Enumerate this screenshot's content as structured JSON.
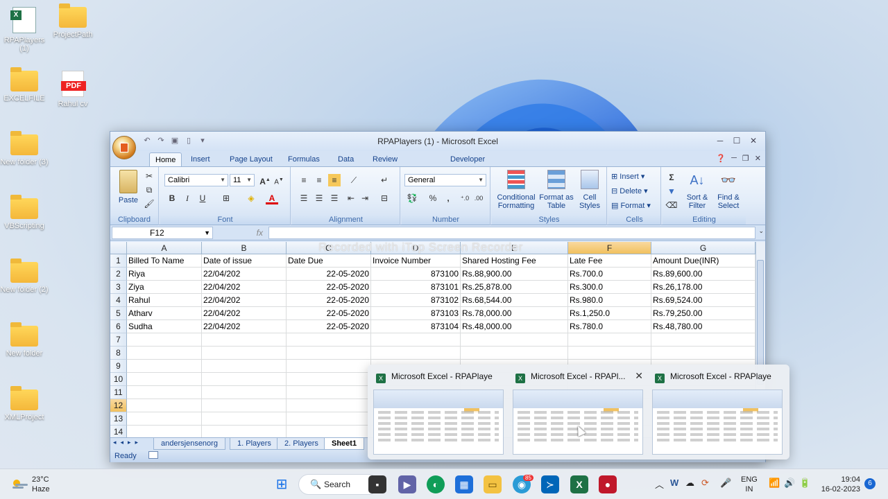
{
  "desktop": {
    "icons": [
      {
        "label": "RPAPlayers (1)",
        "type": "excel"
      },
      {
        "label": "ProjectPath",
        "type": "folder"
      },
      {
        "label": "EXCELFILE",
        "type": "folder"
      },
      {
        "label": "Rahul cv",
        "type": "pdf"
      },
      {
        "label": "New folder (3)",
        "type": "folder"
      },
      {
        "label": "VBScripting",
        "type": "folder"
      },
      {
        "label": "New folder (2)",
        "type": "folder"
      },
      {
        "label": "New folder",
        "type": "folder"
      },
      {
        "label": "XMLProject",
        "type": "folder"
      }
    ],
    "pdf_badge": "PDF",
    "xls_badge": "X"
  },
  "excel": {
    "title": "RPAPlayers (1) - Microsoft Excel",
    "tabs": [
      "Home",
      "Insert",
      "Page Layout",
      "Formulas",
      "Data",
      "Review",
      "Developer"
    ],
    "active_tab": "Home",
    "ribbon": {
      "clipboard": {
        "label": "Clipboard",
        "paste": "Paste"
      },
      "font": {
        "label": "Font",
        "font_name": "Calibri",
        "font_size": "11",
        "bold": "B",
        "italic": "I",
        "underline": "U"
      },
      "alignment": {
        "label": "Alignment"
      },
      "number": {
        "label": "Number",
        "format": "General",
        "percent": "%",
        "comma": ","
      },
      "styles": {
        "label": "Styles",
        "conditional": "Conditional Formatting",
        "format_table": "Format as Table",
        "cell_styles": "Cell Styles"
      },
      "cells": {
        "label": "Cells",
        "insert": "Insert",
        "delete": "Delete",
        "format": "Format"
      },
      "editing": {
        "label": "Editing",
        "sort": "Sort & Filter",
        "find": "Find & Select",
        "sigma": "Σ"
      }
    },
    "name_box": "F12",
    "fx": "fx",
    "watermark": "Recorded with iTop Screen Recorder",
    "columns": [
      "A",
      "B",
      "C",
      "D",
      "E",
      "F",
      "G"
    ],
    "selected_column": "F",
    "selected_row": "12",
    "rows": [
      "1",
      "2",
      "3",
      "4",
      "5",
      "6",
      "7",
      "8",
      "9",
      "10",
      "11",
      "12",
      "13",
      "14"
    ],
    "table": [
      [
        "Billed To Name",
        "Date of issue",
        "Date Due",
        "Invoice Number",
        "Shared Hosting Fee",
        "Late Fee",
        "Amount Due(INR)"
      ],
      [
        "Riya",
        "22/04/202",
        "22-05-2020",
        "873100",
        "Rs.88,900.00",
        "Rs.700.0",
        "Rs.89,600.00"
      ],
      [
        "Ziya",
        "22/04/202",
        "22-05-2020",
        "873101",
        "Rs.25,878.00",
        "Rs.300.0",
        "Rs.26,178.00"
      ],
      [
        "Rahul",
        "22/04/202",
        "22-05-2020",
        "873102",
        "Rs.68,544.00",
        "Rs.980.0",
        "Rs.69,524.00"
      ],
      [
        "Atharv",
        "22/04/202",
        "22-05-2020",
        "873103",
        "Rs.78,000.00",
        "Rs.1,250.0",
        "Rs.79,250.00"
      ],
      [
        "Sudha",
        "22/04/202",
        "22-05-2020",
        "873104",
        "Rs.48,000.00",
        "Rs.780.0",
        "Rs.48,780.00"
      ]
    ],
    "sheet_tabs": [
      "andersjensenorg",
      "1. Players",
      "2. Players",
      "Sheet1"
    ],
    "active_sheet": "Sheet1",
    "status": "Ready"
  },
  "previews": [
    {
      "title": "Microsoft Excel - RPAPlayers (..."
    },
    {
      "title": "Microsoft Excel - RPAPl..."
    },
    {
      "title": "Microsoft Excel - RPAPlayers (..."
    }
  ],
  "taskbar": {
    "weather_temp": "23°C",
    "weather_desc": "Haze",
    "search": "Search",
    "lang1": "ENG",
    "lang2": "IN",
    "time": "19:04",
    "date": "16-02-2023",
    "notifications": "6",
    "edge_badge": "85"
  }
}
